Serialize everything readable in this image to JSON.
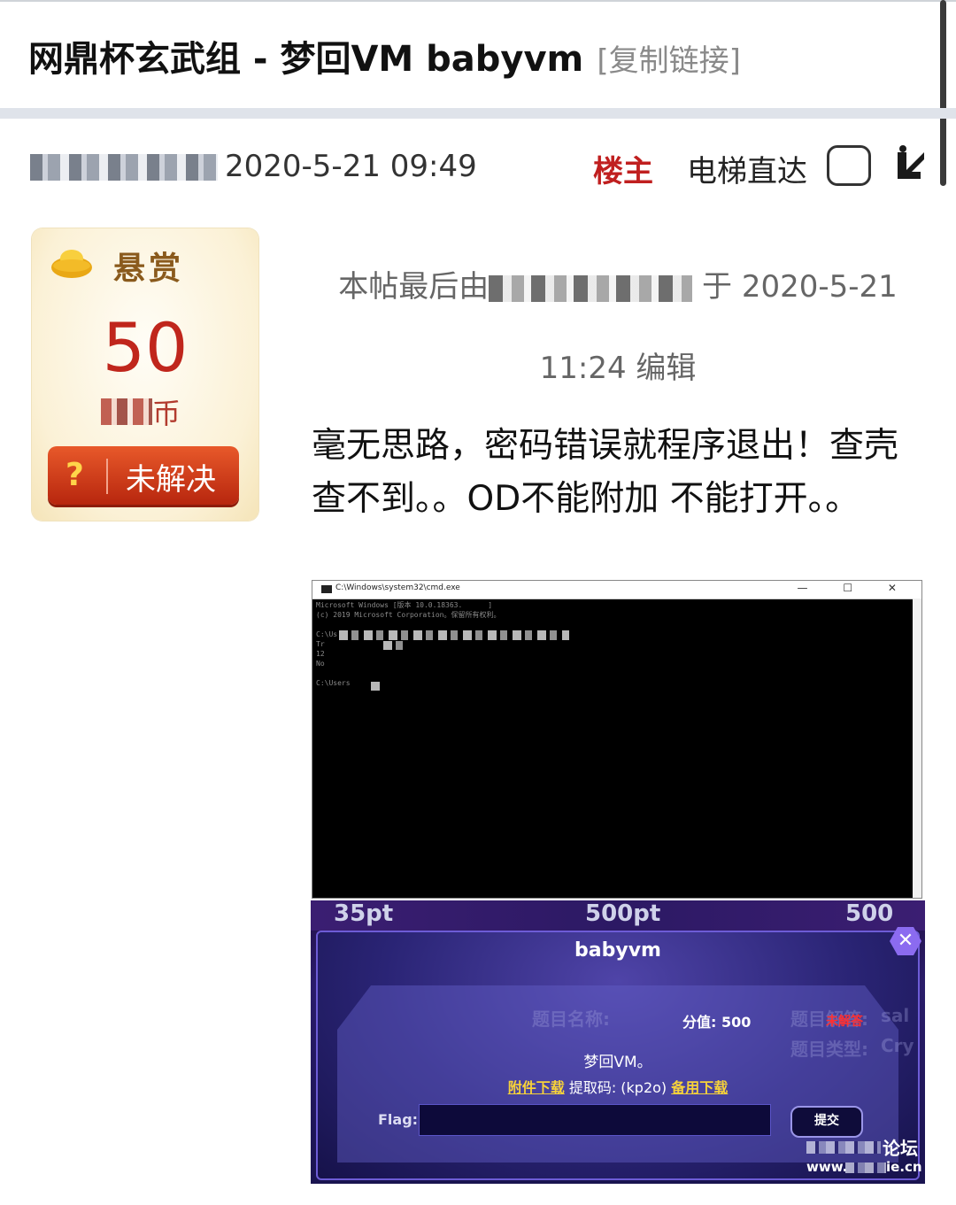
{
  "thread": {
    "title": "网鼎杯玄武组 - 梦回VM babyvm",
    "copy_link": "[复制链接]"
  },
  "post": {
    "date": "2020-5-21 09:49",
    "op_tag": "楼主",
    "elevator_label": "电梯直达",
    "edit_note_prefix": "本帖最后由",
    "edit_note_mid": "于 2020-5-21",
    "edit_note_line2": "11:24 编辑",
    "body": "毫无思路，密码错误就程序退出！查壳查不到。。OD不能附加 不能打开。。"
  },
  "reward": {
    "label": "悬赏",
    "amount": "50",
    "currency_suffix": "币",
    "status_icon": "?",
    "status": "未解决"
  },
  "cmd_window": {
    "title": "C:\\Windows\\system32\\cmd.exe",
    "controls": "— ☐ ✕",
    "lines": "Microsoft Windows [版本 10.0.18363.      ]\n(c) 2019 Microsoft Corporation。保留所有权利。\n\nC:\\Us\nTr\n12\nNo\n\nC:\\Users"
  },
  "ctf": {
    "pts": [
      "35pt",
      "500pt",
      "500"
    ],
    "title": "babyvm",
    "score": "分值: 500",
    "status": "未解答",
    "ghost_name": "题目名称:",
    "ghost_solves": "题目解答:",
    "ghost_type": "题目类型:",
    "ghost_type_val": "Cry",
    "ghost_solve_val": "sal",
    "description": "梦回VM。",
    "attachment_link": "附件下载",
    "extract_code": "提取码: (kp2o)",
    "backup_link": "备用下载",
    "flag_label": "Flag:",
    "submit": "提交",
    "watermark": "论坛",
    "watermark_url": "www.",
    "watermark_url_tail": "ie.cn"
  },
  "colors": {
    "op_red": "#c01f1f",
    "reward_red": "#c0261c",
    "ctf_purple": "#2a1c6a",
    "status_red": "#ff3030",
    "link_yellow": "#f7d23a"
  }
}
